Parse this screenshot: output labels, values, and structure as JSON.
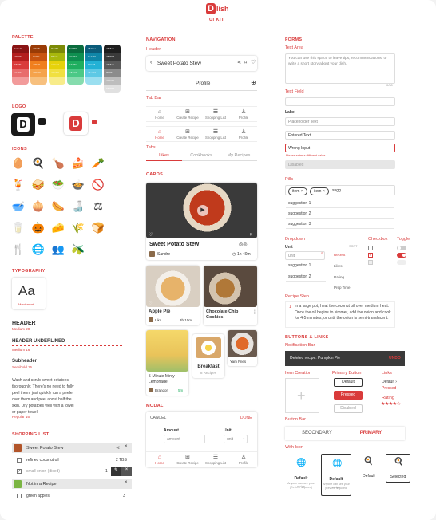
{
  "brand": {
    "logo_letter": "D",
    "logo_text": "lish",
    "subtitle": "UI KIT"
  },
  "colors": {
    "primary": "#d93b3b"
  },
  "palette": {
    "title": "PALETTE",
    "columns": [
      {
        "swatches": [
          "#8a1414",
          "#b31e1e",
          "#d93b3b",
          "#e86c6c",
          "#f29b9b"
        ],
        "labels": [
          "bebe1b",
          "d3f89b",
          "bfb4f9",
          "eb4f4f"
        ]
      },
      {
        "swatches": [
          "#9a3b06",
          "#c85410",
          "#f07f1e",
          "#f5a34c",
          "#f7c07e"
        ],
        "labels": [
          "d0b7fb",
          "1a6ff0",
          "ef4b40",
          "c28a09"
        ]
      },
      {
        "swatches": [
          "#7c8a07",
          "#a8b80c",
          "#e6d20b",
          "#f1e040",
          "#f8ec8a"
        ],
        "labels": [
          "fbd780",
          "ff4ae9",
          "ac5e42",
          "ebbc50"
        ]
      },
      {
        "swatches": [
          "#0a6b3d",
          "#0f8f50",
          "#1fae5f",
          "#4bc986",
          "#86dcae"
        ],
        "labels": [
          "5c9f65",
          "7d1f6d",
          "b43f8a",
          "e8a4c8"
        ]
      },
      {
        "swatches": [
          "#0b5c7a",
          "#0f86a8",
          "#23b1d5",
          "#5dc9e5",
          "#9bdff0"
        ],
        "labels": [
          "78d3ea",
          "1e4e39",
          "9fa1b8",
          "e4e2dd"
        ]
      },
      {
        "swatches": [
          "#1e1e1e",
          "#3a3a3a",
          "#5a5a5a",
          "#8c8c8c",
          "#bdbdbd",
          "#e0e0e0"
        ],
        "labels": [
          "c8c8c8",
          "282828",
          "c8c8c8",
          "f6f6f6",
          "434343",
          "686868"
        ]
      }
    ]
  },
  "logo": {
    "title": "LOGO"
  },
  "icons": {
    "title": "ICONS",
    "names": [
      "egg-icon",
      "fried-egg-icon",
      "drumstick-icon",
      "cake-slice-icon",
      "carrot-icon",
      "cocktail-icon",
      "sandwich-icon",
      "salad-bowl-icon",
      "pot-icon",
      "no-entry-icon",
      "bowl-icon",
      "onion-icon",
      "sausage-icon",
      "sauce-bottle-icon",
      "scale-weight-icon",
      "milk-bottles-icon",
      "pumpkin-icon",
      "cheese-icon",
      "wheat-icon",
      "bread-slice-icon",
      "utensils-icon",
      "globe-icon",
      "users-icon",
      "cooking-oil-icon"
    ],
    "glyphs": [
      "🥚",
      "🍳",
      "🍗",
      "🍰",
      "🥕",
      "🍹",
      "🥪",
      "🥗",
      "🍲",
      "🚫",
      "🥣",
      "🧅",
      "🌭",
      "🍶",
      "⚖",
      "🥛",
      "🎃",
      "🧀",
      "🌾",
      "🍞",
      "🍴",
      "🌐",
      "👥",
      "🫒"
    ]
  },
  "typography": {
    "title": "TYPOGRAPHY",
    "sample": "Aa",
    "font_name": "Montserrat",
    "header": "HEADER",
    "header_meta": "Medium 20",
    "header_underlined": "HEADER UNDERLINED",
    "header_underlined_meta": "Medium 16",
    "subheader": "Subheader",
    "subheader_meta": "Semibold 16",
    "body": "Wash and scrub sweet potatoes thoroughly. There's no need to fully peel them, just quickly run a peeler over them and peel about half the skin. Dry potatoes well with a towel or paper towel.",
    "body_meta": "Regular 16"
  },
  "shopping_list": {
    "title": "SHOPPING LIST",
    "groups": [
      {
        "name": "Sweet Potato Stew",
        "items": [
          {
            "name": "refined coconut oil",
            "qty": "2 TBS"
          },
          {
            "name": "small onion (diced)",
            "qty": "1"
          }
        ]
      },
      {
        "name": "Not in a Recipe",
        "items": [
          {
            "name": "green apples",
            "qty": "3"
          }
        ]
      }
    ]
  },
  "navigation": {
    "title": "NAVIGATION",
    "header_label": "Header",
    "header_title": "Sweet Potato Stew",
    "profile_title": "Profile",
    "tabbar_label": "Tab Bar",
    "tabbar_items": [
      "Home",
      "Create Recipe",
      "Shopping List",
      "Profile"
    ],
    "tabs_label": "Tabs",
    "tabs": [
      "Likes",
      "Cookbooks",
      "My Recipes"
    ]
  },
  "cards": {
    "title": "CARDS",
    "featured": {
      "title": "Sweet Potato Stew",
      "author": "Sandre",
      "time": "1h 40m"
    },
    "small": [
      {
        "title": "Apple Pie",
        "author": "Lika",
        "time": "3h 10m"
      },
      {
        "title": "Chocolate Chip Cookies"
      }
    ],
    "row3": [
      {
        "title": "5-Minute Minty Lemonade",
        "author": "Brandon",
        "time": "5m"
      },
      {
        "title": "Breakfast",
        "count": "8 Recipes"
      },
      {
        "title": "Yam Fries"
      }
    ]
  },
  "modal": {
    "title": "MODAL",
    "cancel": "CANCEL",
    "done": "DONE",
    "amount_label": "Amount",
    "amount_placeholder": "amount",
    "unit_label": "Unit",
    "unit_placeholder": "unit"
  },
  "forms": {
    "title": "FORMS",
    "text_area_label": "Text Area",
    "text_area_placeholder": "You can use this space to leave tips, recommendations, or write a short story about your dish.",
    "text_area_count": "0/50",
    "text_field_label": "Text Field",
    "label_label": "Label",
    "placeholder_text": "Placeholder Text",
    "entered_text": "Entered Text",
    "wrong_input": "Wrong Input",
    "error_text": "Please enter a different value",
    "disabled": "Disabled"
  },
  "pills": {
    "title": "Pills",
    "items": [
      "item",
      "item"
    ],
    "input_value": "sugg",
    "suggestions": [
      "suggestion 1",
      "suggestion 2",
      "suggestion 3"
    ]
  },
  "dropdown": {
    "title": "Dropdown",
    "unit_label": "Unit",
    "unit_value": "unit",
    "options": [
      "suggestion 1",
      "suggestion 2"
    ],
    "sort_label": "SORT",
    "sort_value": "Recent",
    "sort_options": [
      "Likes",
      "Rating",
      "Prep Time"
    ]
  },
  "checkbox": {
    "title": "Checkbox"
  },
  "toggle": {
    "title": "Toggle"
  },
  "recipe_step": {
    "title": "Recipe Step",
    "number": "1",
    "text": "In a large pot, heat the coconut oil over medium heat. Once the oil begins to simmer, add the onion and cook for 4-5 minutes, or until the onion is semi-translucent."
  },
  "buttons": {
    "title": "BUTTONS & LINKS",
    "notification_label": "Notification Bar",
    "notification_text": "Deleted recipe: Pumpkin Pie",
    "undo": "UNDO",
    "item_creation_label": "Item Creation",
    "primary_label": "Primary Button",
    "default": "Default",
    "pressed": "Pressed",
    "disabled": "Disabled",
    "links_label": "Links",
    "link_default": "Default",
    "link_pressed": "Pressed",
    "rating_label": "Rating",
    "rating_value": 4,
    "button_bar_label": "Button Bar",
    "secondary": "SECONDARY",
    "primary": "PRIMARY",
    "with_icon_label": "With Icon",
    "icon_buttons": [
      {
        "label": "Default",
        "sub": "Anyone can see your recipe",
        "note": "(Review required)"
      },
      {
        "label": "Default",
        "sub": "Anyone can see your recipe",
        "note": "(Review required)"
      },
      {
        "label": "Default"
      },
      {
        "label": "Selected"
      }
    ]
  }
}
